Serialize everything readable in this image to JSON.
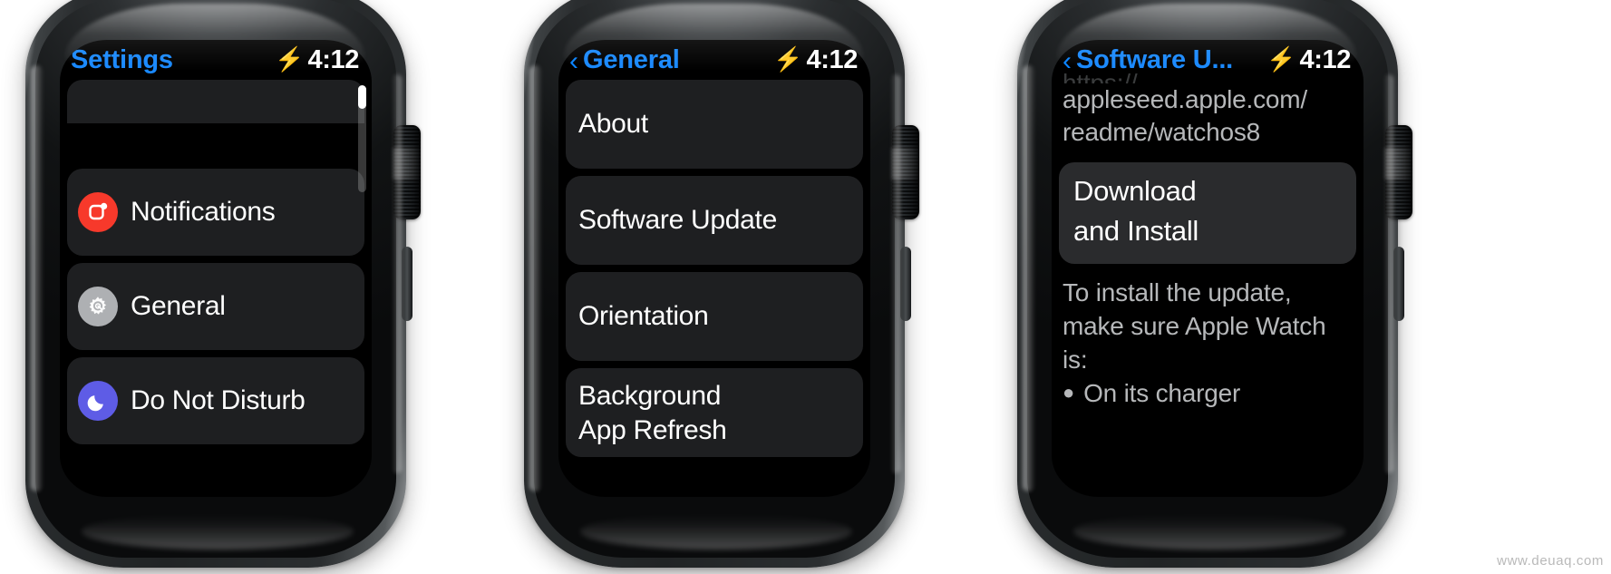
{
  "meta": {
    "watermark": "www.deuaq.com"
  },
  "status": {
    "time": "4:12",
    "charging_icon": "bolt-icon",
    "bolt_glyph": "⚡",
    "back_glyph": "‹",
    "accent_blue": "#1989ff",
    "charging_green": "#30d158"
  },
  "watches": [
    {
      "id": "watch-settings",
      "title": "Settings",
      "has_back": false,
      "scroll": {
        "visible": true
      },
      "rows": [
        {
          "kind": "partial",
          "label": ""
        },
        {
          "kind": "gap"
        },
        {
          "kind": "icon",
          "label": "Notifications",
          "icon": "notifications-icon",
          "icon_color": "#f7392b"
        },
        {
          "kind": "icon",
          "label": "General",
          "icon": "gear-icon",
          "icon_color": "#aeb0b3"
        },
        {
          "kind": "icon",
          "label": "Do Not Disturb",
          "icon": "moon-icon",
          "icon_color": "#5e5ce6"
        }
      ]
    },
    {
      "id": "watch-general",
      "title": "General",
      "has_back": true,
      "scroll": {
        "visible": false
      },
      "rows": [
        {
          "kind": "plain",
          "label": "About"
        },
        {
          "kind": "plain",
          "label": "Software Update"
        },
        {
          "kind": "plain",
          "label": "Orientation"
        },
        {
          "kind": "two-line",
          "line1": "Background",
          "line2": "App Refresh"
        }
      ]
    },
    {
      "id": "watch-software-update",
      "title": "Software U...",
      "has_back": true,
      "scroll": {
        "visible": false
      },
      "url": {
        "clipped_line": "https://",
        "line1": "appleseed.apple.com/",
        "line2": "readme/watchos8"
      },
      "button": {
        "name": "download-and-install-button",
        "line1": "Download",
        "line2": "and Install"
      },
      "note": {
        "line1": "To install the update,",
        "line2": "make sure Apple Watch",
        "line3": "is:"
      },
      "bullets": [
        {
          "text": "On its charger"
        }
      ]
    }
  ]
}
